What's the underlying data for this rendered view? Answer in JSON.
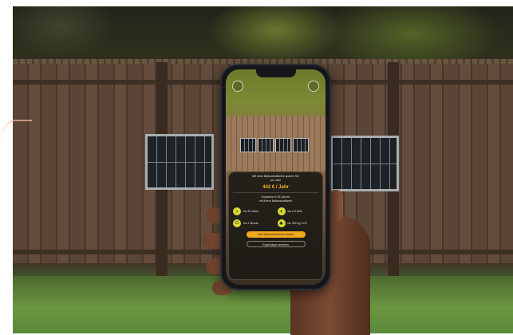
{
  "phone_app": {
    "intro_line1": "Mit einer Balkonkraftwerk sparen Sie",
    "intro_line2": "pro Jahr",
    "savings_amount": "442 € / Jahr",
    "subtitle_line1": "Ersparnis in 25 Jahren",
    "subtitle_line2": "mit Ihrem Balkonkraftwerk",
    "stats": [
      {
        "icon": "lightning-icon",
        "label": "bis 25 Jahre"
      },
      {
        "icon": "sun-icon",
        "label": "bis 2.5 kWh"
      },
      {
        "icon": "plug-icon",
        "label": "bis 1 Minute"
      },
      {
        "icon": "leaf-icon",
        "label": "bis 300 kg CO2"
      }
    ],
    "primary_button": "Jetzt Balkonkraftwerk kaufen",
    "secondary_button": "Ergebnisse ansehen"
  },
  "colors": {
    "accent": "#f1a91d",
    "stat_icon": "#d8dc35",
    "sheet_bg": "#1c1a16"
  }
}
